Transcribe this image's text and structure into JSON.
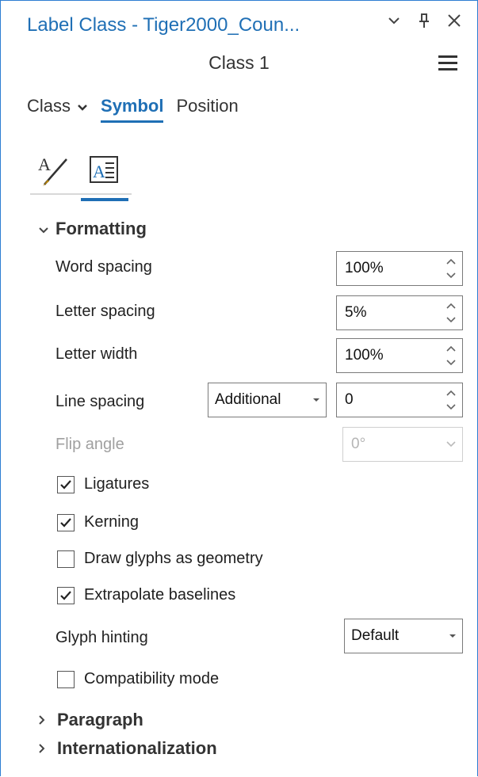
{
  "window": {
    "title": "Label Class - Tiger2000_Coun...",
    "subtitle": "Class 1"
  },
  "tabs": [
    {
      "label": "Class",
      "has_dropdown": true
    },
    {
      "label": "Symbol",
      "active": true
    },
    {
      "label": "Position"
    }
  ],
  "subtabs": [
    {
      "icon": "text-style-icon",
      "active": false
    },
    {
      "icon": "text-formatting-icon",
      "active": true
    }
  ],
  "formatting": {
    "header": "Formatting",
    "word_spacing": {
      "label": "Word spacing",
      "value": "100%"
    },
    "letter_spacing": {
      "label": "Letter spacing",
      "value": "5%"
    },
    "letter_width": {
      "label": "Letter width",
      "value": "100%"
    },
    "line_spacing": {
      "label": "Line spacing",
      "mode": "Additional",
      "value": "0"
    },
    "flip_angle": {
      "label": "Flip angle",
      "value": "0°",
      "disabled": true
    },
    "ligatures": {
      "label": "Ligatures",
      "checked": true
    },
    "kerning": {
      "label": "Kerning",
      "checked": true
    },
    "draw_glyphs": {
      "label": "Draw glyphs as geometry",
      "checked": false
    },
    "extrapolate": {
      "label": "Extrapolate baselines",
      "checked": true
    },
    "glyph_hinting": {
      "label": "Glyph hinting",
      "value": "Default"
    },
    "compatibility": {
      "label": "Compatibility mode",
      "checked": false
    }
  },
  "sections": {
    "paragraph": "Paragraph",
    "internationalization": "Internationalization"
  },
  "colors": {
    "accent": "#1f6fb5",
    "border": "#2d7dd2"
  }
}
